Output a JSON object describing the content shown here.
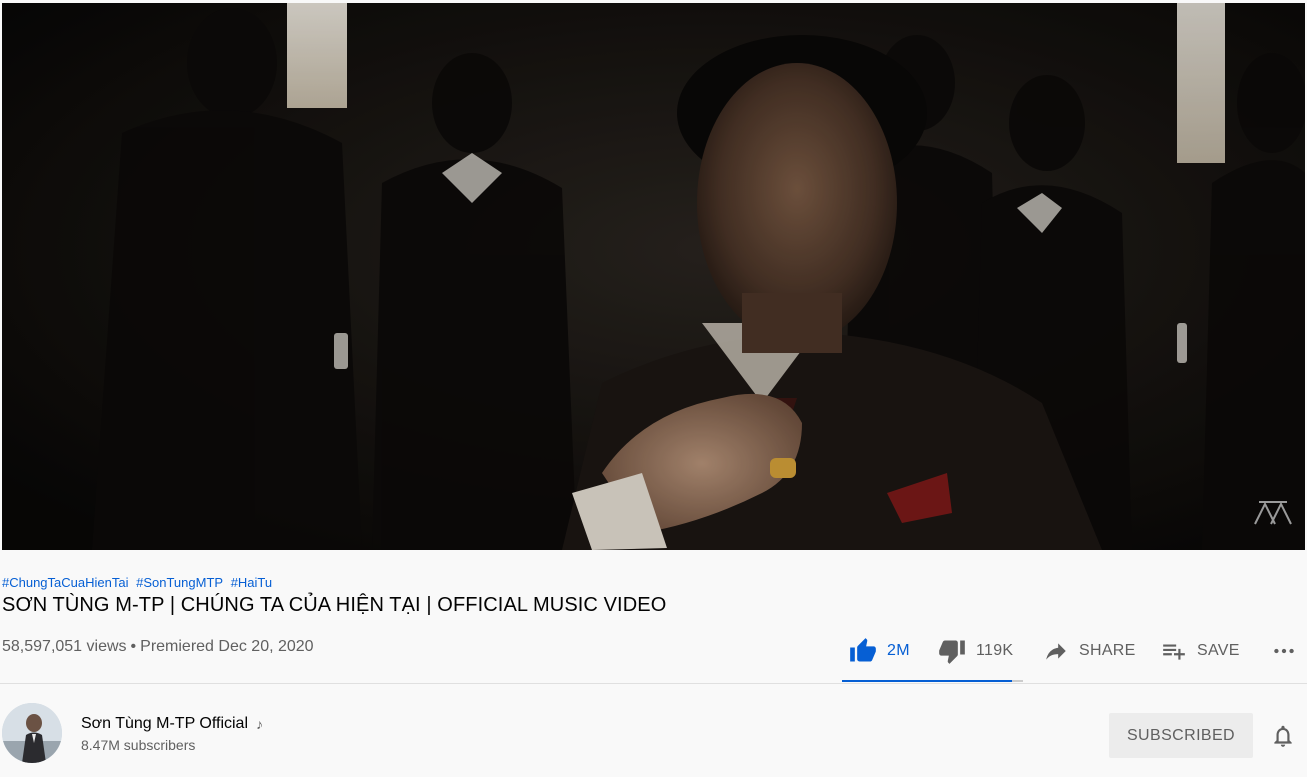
{
  "video": {
    "hashtags": [
      "#ChungTaCuaHienTai",
      "#SonTungMTP",
      "#HaiTu"
    ],
    "title": "SƠN TÙNG M-TP | CHÚNG TA CỦA HIỆN TẠI | OFFICIAL MUSIC VIDEO",
    "views": "58,597,051 views",
    "separator": "•",
    "premiered": "Premiered Dec 20, 2020"
  },
  "actions": {
    "like_count": "2M",
    "dislike_count": "119K",
    "share_label": "SHARE",
    "save_label": "SAVE",
    "like_ratio": 0.94,
    "like_icon": "thumb-up-icon",
    "dislike_icon": "thumb-down-icon",
    "share_icon": "share-arrow-icon",
    "save_icon": "playlist-add-icon",
    "more_icon": "more-horizontal-icon"
  },
  "owner": {
    "channel_name": "Sơn Tùng M-TP Official",
    "verified_icon": "music-note-icon",
    "subscribers": "8.47M subscribers",
    "subscribe_label": "SUBSCRIBED",
    "bell_icon": "notification-bell-icon"
  },
  "colors": {
    "accent": "#065fd4",
    "secondary_text": "#606060",
    "page_bg": "#f9f9f9"
  }
}
